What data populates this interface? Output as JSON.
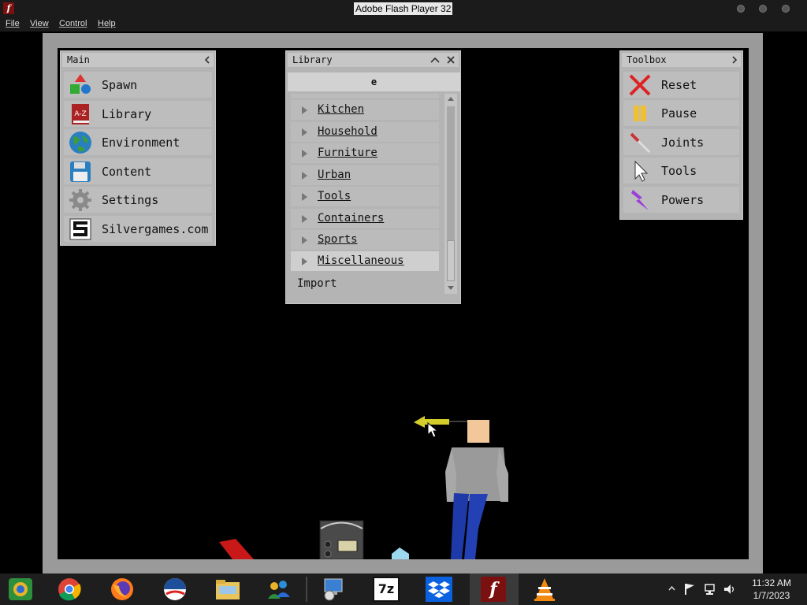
{
  "window": {
    "title": "Adobe Flash Player 32"
  },
  "menu": [
    "File",
    "View",
    "Control",
    "Help"
  ],
  "main_panel": {
    "title": "Main",
    "items": [
      {
        "label": "Spawn",
        "icon": "shapes-icon"
      },
      {
        "label": "Library",
        "icon": "book-icon",
        "badge": "A-Z"
      },
      {
        "label": "Environment",
        "icon": "globe-icon"
      },
      {
        "label": "Content",
        "icon": "floppy-disk-icon"
      },
      {
        "label": "Settings",
        "icon": "gear-icon"
      },
      {
        "label": "Silvergames.com",
        "icon": "silvergames-logo-icon"
      }
    ]
  },
  "library_panel": {
    "title": "Library",
    "search_value": "e",
    "items": [
      "Kitchen",
      "Household",
      "Furniture",
      "Urban",
      "Tools",
      "Containers",
      "Sports",
      "Miscellaneous"
    ],
    "selected": "Miscellaneous",
    "import_label": "Import"
  },
  "toolbox_panel": {
    "title": "Toolbox",
    "items": [
      {
        "label": "Reset",
        "icon": "x-icon"
      },
      {
        "label": "Pause",
        "icon": "pause-icon"
      },
      {
        "label": "Joints",
        "icon": "pin-icon"
      },
      {
        "label": "Tools",
        "icon": "cursor-icon"
      },
      {
        "label": "Powers",
        "icon": "lightning-icon"
      }
    ]
  },
  "taskbar": {
    "clock_time": "11:32 AM",
    "clock_date": "1/7/2023",
    "seven_zip_label": "7z"
  },
  "colors": {
    "accent_flash": "#7a1010",
    "panel_bg": "#b4b4b4",
    "stage_bg": "#000000"
  }
}
